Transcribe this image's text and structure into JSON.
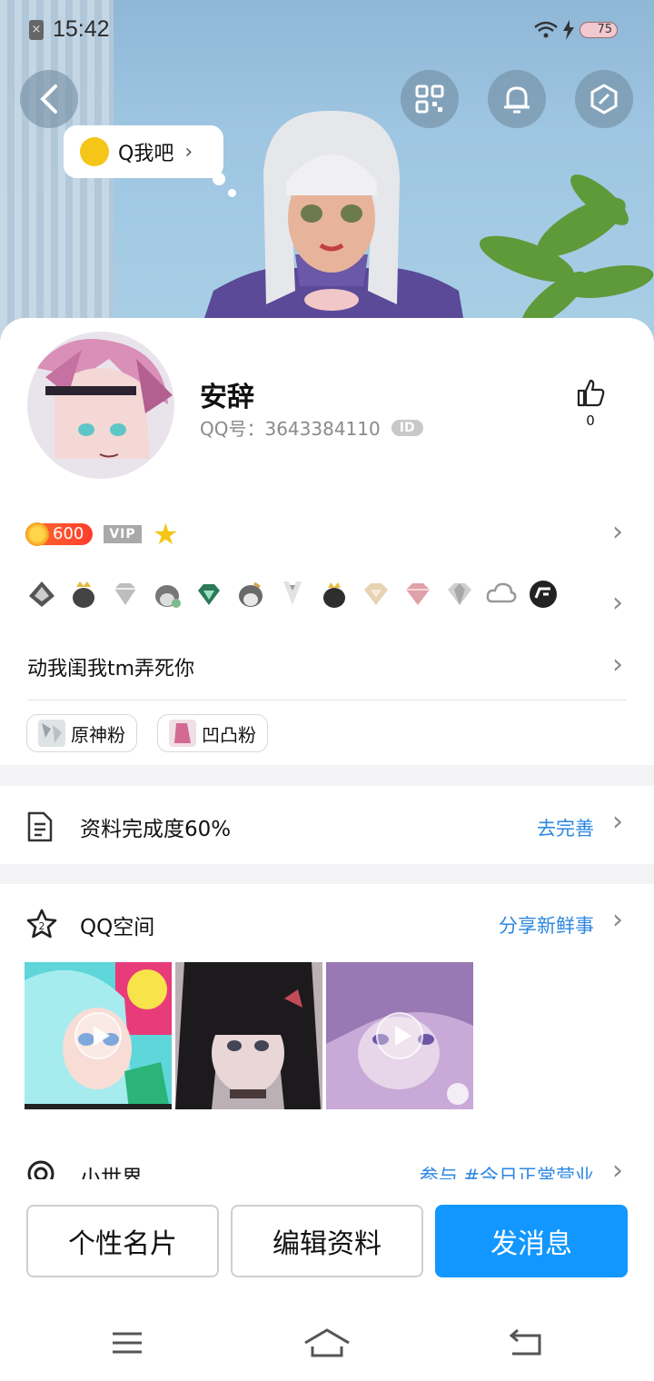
{
  "status_bar": {
    "time": "15:42",
    "battery": "75"
  },
  "hero": {
    "qbubble_label": "Q我吧"
  },
  "profile": {
    "nickname": "安辞",
    "qq_label": "QQ号：3643384110",
    "id_badge": "ID",
    "like_count": "0",
    "coin_value": "600",
    "vip_label": "VIP",
    "signature": "动我闺我tm弄死你",
    "tags": [
      {
        "label": "原神粉"
      },
      {
        "label": "凹凸粉"
      }
    ]
  },
  "completion": {
    "title": "资料完成度60%",
    "link": "去完善"
  },
  "qzone": {
    "title": "QQ空间",
    "link": "分享新鲜事",
    "icon_number": "2"
  },
  "world": {
    "title": "小世界",
    "link": "参与 #今日正常营业"
  },
  "actions": {
    "card_label": "个性名片",
    "edit_label": "编辑资料",
    "message_label": "发消息"
  },
  "icons": [
    "back-icon",
    "qr-code-icon",
    "bell-icon",
    "settings-hexagon-icon",
    "thumbs-up-icon",
    "document-icon",
    "star-icon",
    "circle-icon",
    "menu-icon",
    "home-icon",
    "return-icon"
  ]
}
